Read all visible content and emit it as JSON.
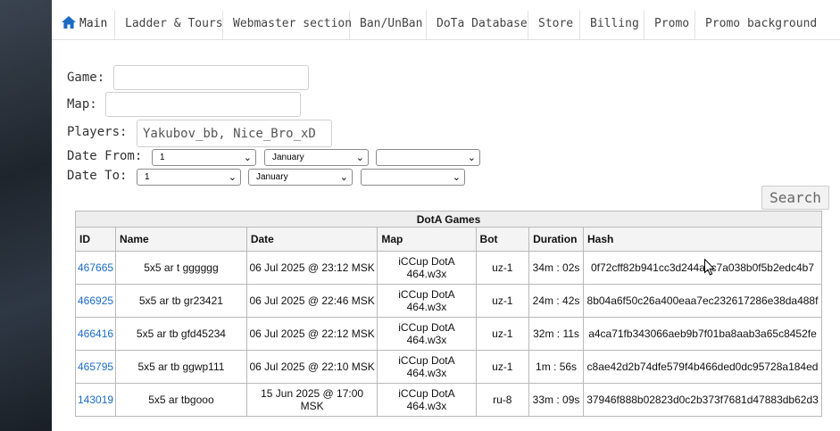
{
  "nav": {
    "items": [
      {
        "label": "Main",
        "icon": "home-icon"
      },
      {
        "label": "Ladder & Tours"
      },
      {
        "label": "Webmaster section"
      },
      {
        "label": "Ban/UnBan"
      },
      {
        "label": "DoTa Database"
      },
      {
        "label": "Store"
      },
      {
        "label": "Billing"
      },
      {
        "label": "Promo"
      },
      {
        "label": "Promo background"
      }
    ],
    "icon_color": "#1a6bc4"
  },
  "form": {
    "game_label": "Game:",
    "game_value": "",
    "map_label": "Map:",
    "map_value": "",
    "players_label": "Players:",
    "players_value": "Yakubov_bb, Nice_Bro_xD",
    "date_from_label": "Date From:",
    "date_from_day": "1",
    "date_from_month": "January",
    "date_from_year": "",
    "date_to_label": "Date To:",
    "date_to_day": "1",
    "date_to_month": "January",
    "date_to_year": "",
    "search_label": "Search"
  },
  "table": {
    "title": "DotA Games",
    "columns": [
      "ID",
      "Name",
      "Date",
      "Map",
      "Bot",
      "Duration",
      "Hash"
    ],
    "rows": [
      {
        "id": "467665",
        "name": "5x5 ar t gggggg",
        "date": "06 Jul 2025 @ 23:12 MSK",
        "map_line1": "iCCup DotA",
        "map_line2": "464.w3x",
        "bot": "uz-1",
        "duration": "34m : 02s",
        "hash": "0f72cff82b941cc3d244a5c7a038b0f5b2edc4b7"
      },
      {
        "id": "466925",
        "name": "5x5 ar tb gr23421",
        "date": "06 Jul 2025 @ 22:46 MSK",
        "map_line1": "iCCup DotA",
        "map_line2": "464.w3x",
        "bot": "uz-1",
        "duration": "24m : 42s",
        "hash": "8b04a6f50c26a400eaa7ec232617286e38da488f"
      },
      {
        "id": "466416",
        "name": "5x5 ar tb gfd45234",
        "date": "06 Jul 2025 @ 22:12 MSK",
        "map_line1": "iCCup DotA",
        "map_line2": "464.w3x",
        "bot": "uz-1",
        "duration": "32m : 11s",
        "hash": "a4ca71fb343066aeb9b7f01ba8aab3a65c8452fe"
      },
      {
        "id": "465795",
        "name": "5x5 ar tb ggwp111",
        "date": "06 Jul 2025 @ 22:10 MSK",
        "map_line1": "iCCup DotA",
        "map_line2": "464.w3x",
        "bot": "uz-1",
        "duration": "1m : 56s",
        "hash": "c8ae42d2b74dfe579f4b466ded0dc95728a184ed"
      },
      {
        "id": "143019",
        "name": "5x5 ar tbgooo",
        "date": "15 Jun 2025 @ 17:00 MSK",
        "map_line1": "iCCup DotA",
        "map_line2": "464.w3x",
        "bot": "ru-8",
        "duration": "33m : 09s",
        "hash": "37946f888b02823d0c2b373f7681d47883db62d3"
      }
    ],
    "link_color": "#1a6bc4"
  }
}
